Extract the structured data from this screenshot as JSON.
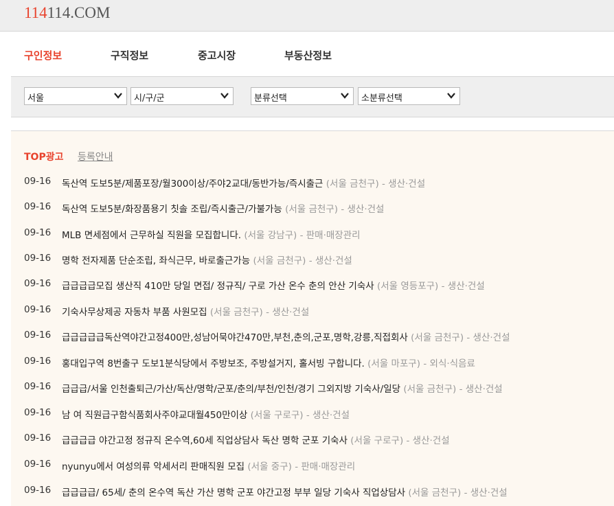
{
  "site": {
    "logo_accent": "114",
    "logo_rest": "114.COM",
    "accent_color": "#e8432d"
  },
  "nav": {
    "items": [
      {
        "label": "구인정보"
      },
      {
        "label": "구직정보"
      },
      {
        "label": "중고시장"
      },
      {
        "label": "부동산정보"
      }
    ],
    "active_index": 0
  },
  "filters": {
    "region": "서울",
    "district": "시/구/군",
    "category": "분류선택",
    "subcategory": "소분류선택"
  },
  "ads": {
    "label": "TOP광고",
    "register_link": "등록안내"
  },
  "listings": [
    {
      "date": "09-16",
      "title": "독산역 도보5분/제품포장/월300이상/주야2교대/동반가능/즉시출근",
      "location": "(서울 금천구)",
      "category": "- 생산·건설"
    },
    {
      "date": "09-16",
      "title": "독산역 도보5분/화장품용기 칫솔 조립/즉시출근/가불가능",
      "location": "(서울 금천구)",
      "category": "- 생산·건설"
    },
    {
      "date": "09-16",
      "title": "MLB 면세점에서 근무하실 직원을 모집합니다.",
      "location": "(서울 강남구)",
      "category": "- 판매·매장관리"
    },
    {
      "date": "09-16",
      "title": "명학 전자제품 단순조립, 좌식근무, 바로출근가능",
      "location": "(서울 금천구)",
      "category": "- 생산·건설"
    },
    {
      "date": "09-16",
      "title": "급급급급모집 생산직 410만 당일 면접/ 정규직/ 구로 가산 온수 춘의 안산 기숙사",
      "location": "(서울 영등포구)",
      "category": "- 생산·건설"
    },
    {
      "date": "09-16",
      "title": "기숙사무상제공 자동차 부품 사원모집",
      "location": "(서울 금천구)",
      "category": "- 생산·건설"
    },
    {
      "date": "09-16",
      "title": "급급급급급독산역야간고정400만,성남어묵야간470만,부천,춘의,군포,명학,강릉,직접회사",
      "location": "(서울 금천구)",
      "category": "- 생산·건설"
    },
    {
      "date": "09-16",
      "title": "홍대입구역 8번출구 도보1분식당에서 주방보조, 주방설거지, 홀서빙 구합니다.",
      "location": "(서울 마포구)",
      "category": "- 외식·식음료"
    },
    {
      "date": "09-16",
      "title": "급급급/서울 인천출퇴근/가산/독산/명학/군포/춘의/부천/인천/경기 그외지방 기숙사/일당",
      "location": "(서울 금천구)",
      "category": "- 생산·건설"
    },
    {
      "date": "09-16",
      "title": "남 여 직원급구함식품회사주야교대월450만이상",
      "location": "(서울 구로구)",
      "category": "- 생산·건설"
    },
    {
      "date": "09-16",
      "title": "급급급급 야간고정 정규직 온수역,60세 직업상담사 독산 명학 군포 기숙사",
      "location": "(서울 구로구)",
      "category": "- 생산·건설"
    },
    {
      "date": "09-16",
      "title": "nyunyu에서 여성의류 악세서리 판매직원 모집",
      "location": "(서울 중구)",
      "category": "- 판매·매장관리"
    },
    {
      "date": "09-16",
      "title": "급급급급/ 65세/ 춘의 온수역 독산 가산 명학 군포 야간고정 부부 일당 기숙사 직업상담사",
      "location": "(서울 금천구)",
      "category": "- 생산·건설"
    }
  ]
}
